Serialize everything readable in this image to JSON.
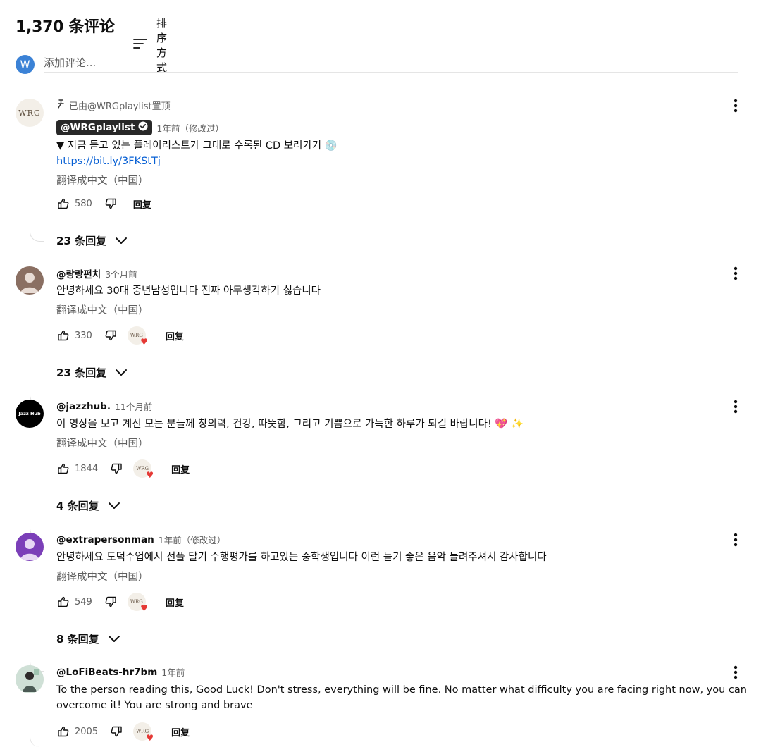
{
  "header": {
    "count": "1,370 条评论",
    "sort_label": "排序方式"
  },
  "add_comment": {
    "avatar_letter": "W",
    "placeholder": "添加评论..."
  },
  "translate_label": "翻译成中文（中国）",
  "reply_label": "回复",
  "comments": [
    {
      "pinned_text": "已由@WRGplaylist置顶",
      "author": "@WRGplaylist",
      "time": "1年前（修改过）",
      "text": "▼ 지금 듣고 있는 플레이리스트가 그대로 수록된 CD 보러가기 💿",
      "link": "https://bit.ly/3FKStTj",
      "likes": "580",
      "replies": "23 条回复",
      "avatar_text": "WRG"
    },
    {
      "author": "@랑랑펀치",
      "time": "3个月前",
      "text": "안녕하세요 30대 중년남성입니다 진짜 아무생각하기 싫습니다",
      "likes": "330",
      "replies": "23 条回复"
    },
    {
      "author": "@jazzhub.",
      "time": "11个月前",
      "text": "이 영상을 보고 계신 모든 분들께 창의력, 건강, 따뜻함, 그리고 기쁨으로 가득한 하루가 되길 바랍니다! 💖 ✨",
      "likes": "1844",
      "replies": "4 条回复",
      "avatar_text": "Jazz Hub"
    },
    {
      "author": "@extrapersonman",
      "time": "1年前（修改过）",
      "text": "안녕하세요 도덕수업에서 선플 달기 수행평가를 하고있는 중학생입니다 이런 듣기 좋은 음악 들려주셔서 감사합니다",
      "likes": "549",
      "replies": "8 条回复"
    },
    {
      "author": "@LoFiBeats-hr7bm",
      "time": "1年前",
      "text": "To the person reading this, Good Luck! Don't stress, everything will be fine. No matter what difficulty you are facing right now, you can overcome it! You are strong and brave",
      "likes": "2005"
    }
  ],
  "icons": {
    "sort": "sort-lines-icon",
    "pin": "pin-icon",
    "verified": "verified-check-icon",
    "like": "thumbs-up-icon",
    "dislike": "thumbs-down-icon",
    "heart": "creator-heart-icon",
    "chevron": "chevron-down-icon",
    "more": "more-vertical-icon"
  },
  "colors": {
    "link": "#065fd4",
    "avatar_user": "#3b82d6",
    "heart": "#e53935",
    "secondary_text": "#606060"
  }
}
